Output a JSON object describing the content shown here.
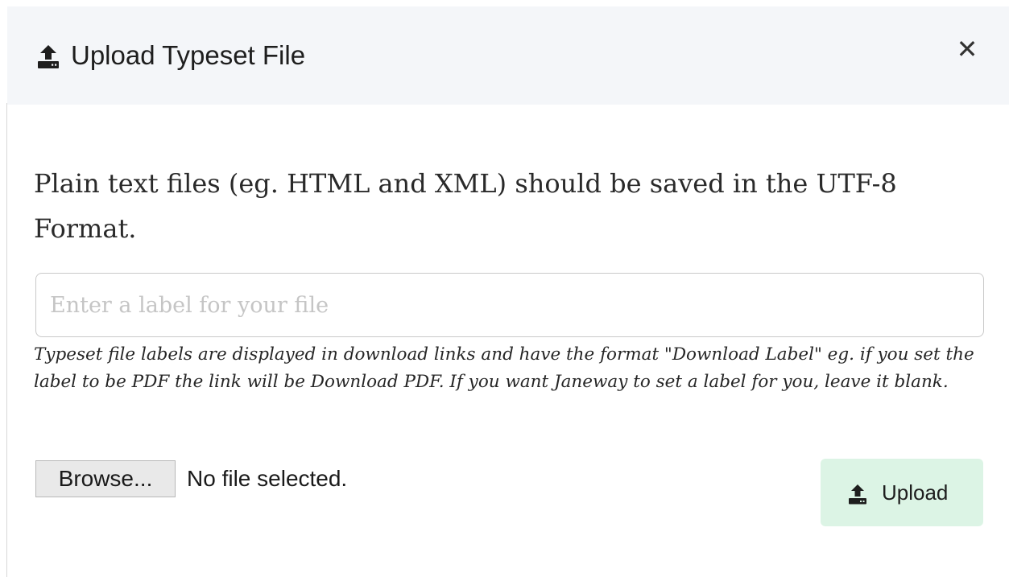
{
  "modal": {
    "title": "Upload Typeset File",
    "title_icon": "upload-icon",
    "close_label": "✕",
    "close_icon": "close-icon"
  },
  "body": {
    "intro": "Plain text files (eg. HTML and XML) should be saved in the UTF-8 Format.",
    "label_input": {
      "value": "",
      "placeholder": "Enter a label for your file"
    },
    "help_text": "Typeset file labels are displayed in download links and have the format \"Download Label\" eg. if you set the label to be PDF the link will be Download PDF. If you want Janeway to set a label for you, leave it blank.",
    "file_picker": {
      "button_label": "Browse...",
      "status": "No file selected."
    },
    "upload_button": {
      "label": "Upload",
      "icon": "upload-icon",
      "color": "#dcf4e5"
    }
  },
  "colors": {
    "header_bg": "#f4f6f9",
    "text": "#1e1e1e"
  }
}
